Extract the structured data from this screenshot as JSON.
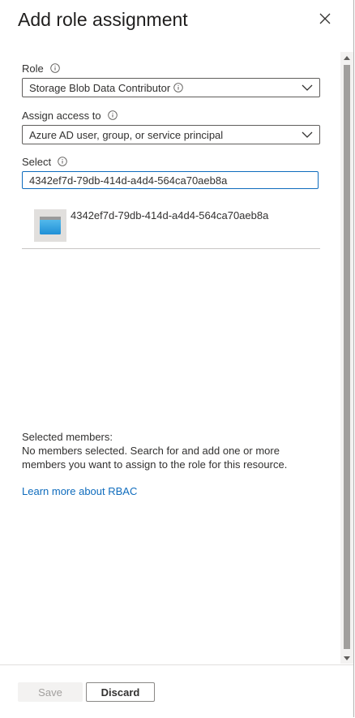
{
  "header": {
    "title": "Add role assignment"
  },
  "icons": {
    "close": "close-icon",
    "info": "info-icon",
    "chevron": "chevron-down-icon",
    "app": "app-registration-icon"
  },
  "role": {
    "label": "Role",
    "value": "Storage Blob Data Contributor"
  },
  "assign_access": {
    "label": "Assign access to",
    "value": "Azure AD user, group, or service principal"
  },
  "select": {
    "label": "Select",
    "value": "4342ef7d-79db-414d-a4d4-564ca70aeb8a"
  },
  "results": [
    {
      "name": "4342ef7d-79db-414d-a4d4-564ca70aeb8a"
    }
  ],
  "members": {
    "heading": "Selected members:",
    "empty_text": "No members selected. Search for and add one or more members you want to assign to the role for this resource."
  },
  "links": {
    "rbac": "Learn more about RBAC"
  },
  "footer": {
    "save_label": "Save",
    "discard_label": "Discard"
  },
  "colors": {
    "accent": "#0f6cbd",
    "border": "#605e5c",
    "disabled_bg": "#f3f2f1"
  }
}
